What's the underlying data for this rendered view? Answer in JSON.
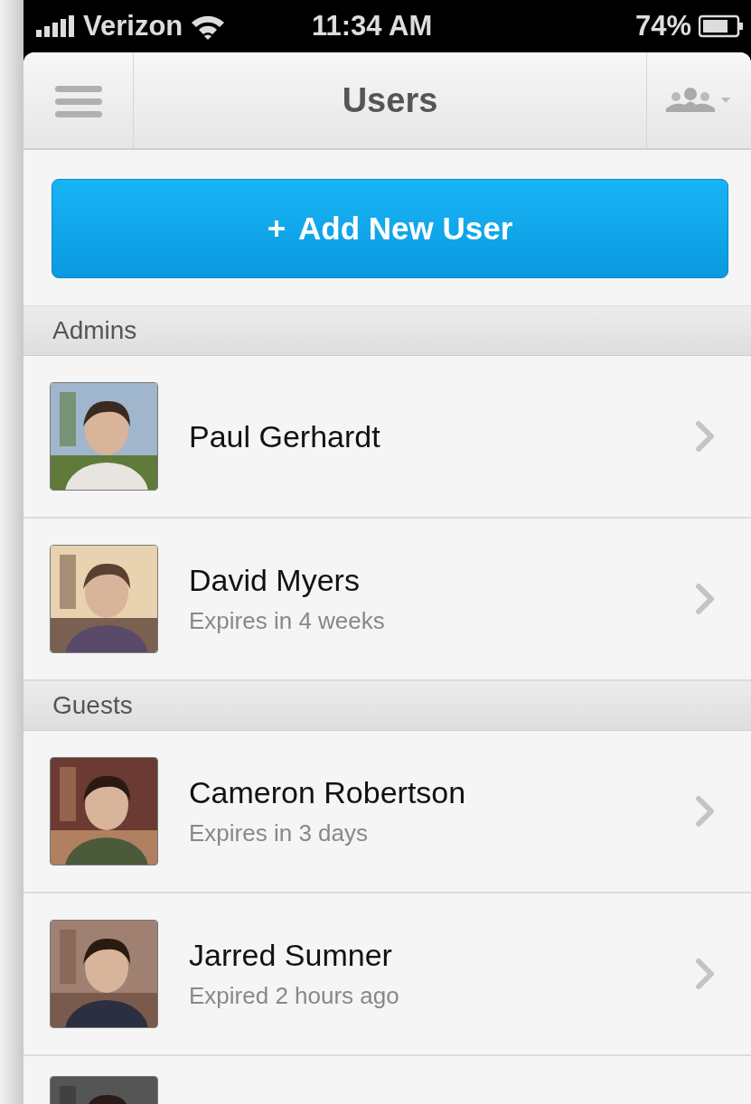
{
  "status_bar": {
    "carrier": "Verizon",
    "time": "11:34 AM",
    "battery": "74%"
  },
  "nav_bar": {
    "title": "Users"
  },
  "add_button": {
    "icon": "+",
    "label": "Add New User"
  },
  "sections": [
    {
      "title": "Admins",
      "users": [
        {
          "kind": "user",
          "name": "Paul Gerhardt"
        },
        {
          "kind": "user",
          "name": "David Myers",
          "subtitle": "Expires in 4 weeks"
        }
      ]
    },
    {
      "title": "Guests",
      "users": [
        {
          "kind": "user",
          "name": "Cameron Robertson",
          "subtitle": "Expires in 3 days"
        },
        {
          "kind": "user",
          "name": "Jarred Sumner",
          "subtitle": "Expired 2 hours ago"
        },
        {
          "kind": "cut_off"
        }
      ]
    }
  ]
}
